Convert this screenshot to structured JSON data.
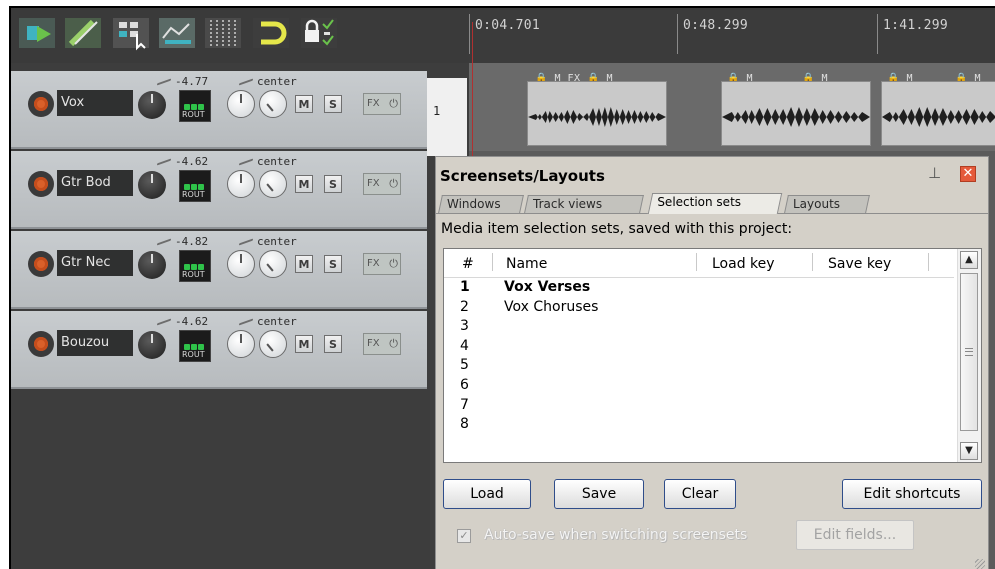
{
  "toolbar": {
    "buttons": [
      {
        "icon": "item-edit-icon"
      },
      {
        "icon": "ripple-link-icon"
      },
      {
        "icon": "grid-select-icon"
      },
      {
        "icon": "envelope-points-icon"
      },
      {
        "icon": "grid-lines-icon"
      },
      {
        "icon": "snap-magnet-icon"
      },
      {
        "icon": "lock-icon"
      }
    ]
  },
  "ruler": {
    "markers": [
      "0:04.701",
      "0:48.299",
      "1:41.299"
    ]
  },
  "tracks": [
    {
      "name": "Vox",
      "volume": "-4.77",
      "pan": "center",
      "number": "1"
    },
    {
      "name": "Gtr Bod",
      "volume": "-4.62",
      "pan": "center"
    },
    {
      "name": "Gtr Nec",
      "volume": "-4.82",
      "pan": "center"
    },
    {
      "name": "Bouzou",
      "volume": "-4.62",
      "pan": "center"
    }
  ],
  "track_buttons": {
    "mute": "M",
    "solo": "S",
    "fx": "FX",
    "power": "⏻",
    "route": "ROUT"
  },
  "media_headers": [
    "🔒 M FX 🔒 M",
    "🔒 M",
    "🔒 M",
    "🔒 M",
    "🔒 M"
  ],
  "dialog": {
    "title": "Screensets/Layouts",
    "tabs": [
      "Windows",
      "Track views",
      "Selection sets",
      "Layouts"
    ],
    "active_tab": "Selection sets",
    "description": "Media item selection sets, saved with this project:",
    "columns": [
      "#",
      "Name",
      "Load key",
      "Save key"
    ],
    "rows": [
      {
        "num": "1",
        "name": "Vox Verses",
        "bold": true
      },
      {
        "num": "2",
        "name": "Vox Choruses",
        "bold": false
      },
      {
        "num": "3",
        "name": "",
        "bold": false
      },
      {
        "num": "4",
        "name": "",
        "bold": false
      },
      {
        "num": "5",
        "name": "",
        "bold": false
      },
      {
        "num": "6",
        "name": "",
        "bold": false
      },
      {
        "num": "7",
        "name": "",
        "bold": false
      },
      {
        "num": "8",
        "name": "",
        "bold": false
      }
    ],
    "buttons": {
      "load": "Load",
      "save": "Save",
      "clear": "Clear",
      "edit_shortcuts": "Edit shortcuts"
    },
    "autosave_label": "Auto-save when switching screensets",
    "autosave_checked": true,
    "edit_fields": "Edit fields..."
  }
}
